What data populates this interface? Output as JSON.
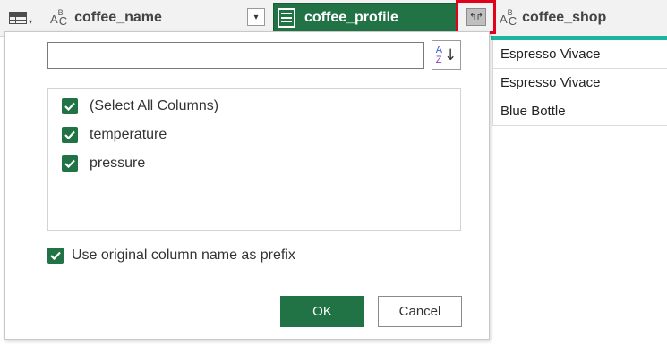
{
  "header": {
    "columns": [
      {
        "name": "coffee_name",
        "type": "text"
      },
      {
        "name": "coffee_profile",
        "type": "record"
      },
      {
        "name": "coffee_shop",
        "type": "text"
      }
    ],
    "type_icon_text": {
      "a": "A",
      "b": "B",
      "c": "C"
    },
    "filter_glyph": "▾",
    "expand_glyph": "↰↱",
    "table_menu_caret": "▾"
  },
  "cells": [
    "Espresso Vivace",
    "Espresso Vivace",
    "Blue Bottle"
  ],
  "expand_panel": {
    "search_value": "",
    "search_placeholder": "",
    "sort_glyph": {
      "top": "A",
      "bottom": "Z",
      "arrow": "↓"
    },
    "items": [
      {
        "label": "(Select All Columns)",
        "checked": true
      },
      {
        "label": "temperature",
        "checked": true
      },
      {
        "label": "pressure",
        "checked": true
      }
    ],
    "prefix_option": {
      "label": "Use original column name as prefix",
      "checked": true
    },
    "ok_label": "OK",
    "cancel_label": "Cancel"
  },
  "colors": {
    "accent_green": "#217346",
    "teal_bar": "#1db5a2",
    "highlight_red": "#e3001b"
  }
}
